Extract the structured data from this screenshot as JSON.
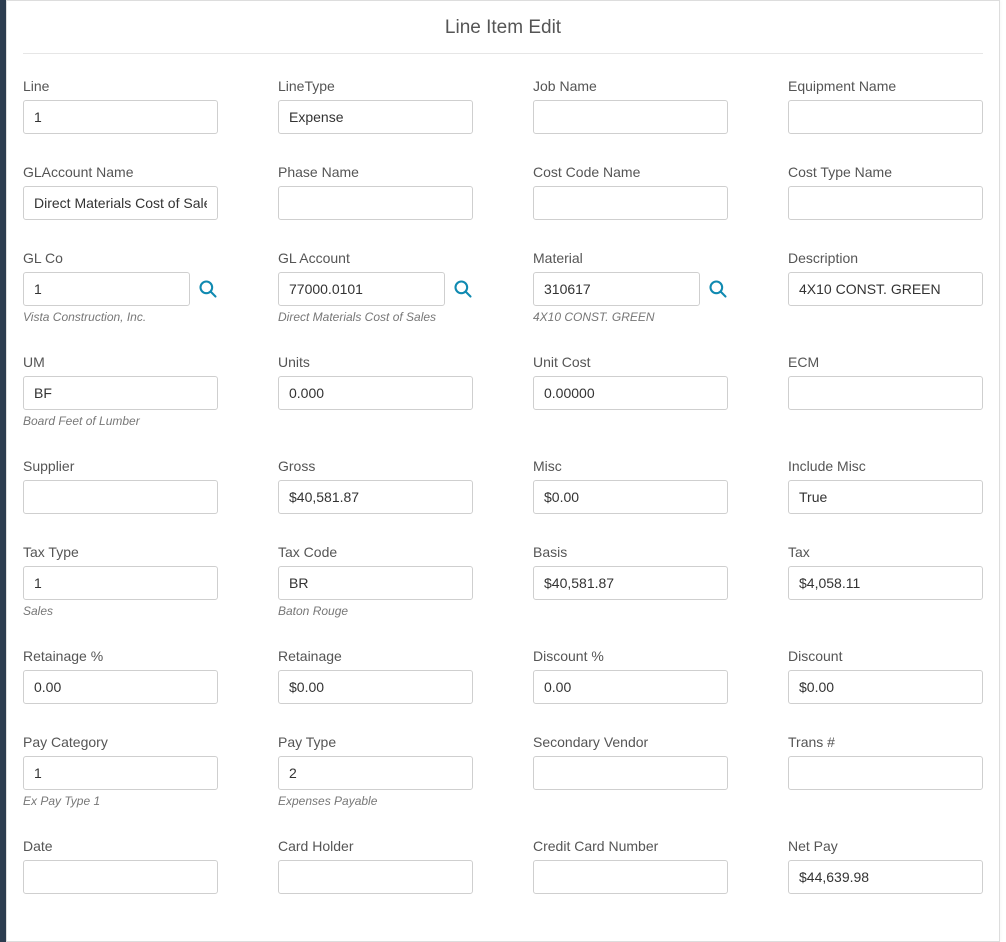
{
  "title": "Line Item Edit",
  "fields": {
    "line": {
      "label": "Line",
      "value": "1"
    },
    "line_type": {
      "label": "LineType",
      "value": "Expense"
    },
    "job_name": {
      "label": "Job Name",
      "value": ""
    },
    "equipment_name": {
      "label": "Equipment Name",
      "value": ""
    },
    "gl_account_name": {
      "label": "GLAccount Name",
      "value": "Direct Materials Cost of Sales"
    },
    "phase_name": {
      "label": "Phase Name",
      "value": ""
    },
    "cost_code_name": {
      "label": "Cost Code Name",
      "value": ""
    },
    "cost_type_name": {
      "label": "Cost Type Name",
      "value": ""
    },
    "gl_co": {
      "label": "GL Co",
      "value": "1",
      "helper": "Vista Construction, Inc."
    },
    "gl_account": {
      "label": "GL Account",
      "value": "77000.0101",
      "helper": "Direct Materials Cost of Sales"
    },
    "material": {
      "label": "Material",
      "value": "310617",
      "helper": "4X10 CONST. GREEN"
    },
    "description": {
      "label": "Description",
      "value": "4X10 CONST. GREEN"
    },
    "um": {
      "label": "UM",
      "value": "BF",
      "helper": "Board Feet of Lumber"
    },
    "units": {
      "label": "Units",
      "value": "0.000"
    },
    "unit_cost": {
      "label": "Unit Cost",
      "value": "0.00000"
    },
    "ecm": {
      "label": "ECM",
      "value": ""
    },
    "supplier": {
      "label": "Supplier",
      "value": ""
    },
    "gross": {
      "label": "Gross",
      "value": "$40,581.87"
    },
    "misc": {
      "label": "Misc",
      "value": "$0.00"
    },
    "include_misc": {
      "label": "Include Misc",
      "value": "True"
    },
    "tax_type": {
      "label": "Tax Type",
      "value": "1",
      "helper": "Sales"
    },
    "tax_code": {
      "label": "Tax Code",
      "value": "BR",
      "helper": "Baton Rouge"
    },
    "basis": {
      "label": "Basis",
      "value": "$40,581.87"
    },
    "tax": {
      "label": "Tax",
      "value": "$4,058.11"
    },
    "retainage_pct": {
      "label": "Retainage %",
      "value": "0.00"
    },
    "retainage": {
      "label": "Retainage",
      "value": "$0.00"
    },
    "discount_pct": {
      "label": "Discount %",
      "value": "0.00"
    },
    "discount": {
      "label": "Discount",
      "value": "$0.00"
    },
    "pay_category": {
      "label": "Pay Category",
      "value": "1",
      "helper": "Ex Pay Type 1"
    },
    "pay_type": {
      "label": "Pay Type",
      "value": "2",
      "helper": "Expenses Payable"
    },
    "secondary_vendor": {
      "label": "Secondary Vendor",
      "value": ""
    },
    "trans_no": {
      "label": "Trans #",
      "value": ""
    },
    "date": {
      "label": "Date",
      "value": ""
    },
    "card_holder": {
      "label": "Card Holder",
      "value": ""
    },
    "credit_card_number": {
      "label": "Credit Card Number",
      "value": ""
    },
    "net_pay": {
      "label": "Net Pay",
      "value": "$44,639.98"
    }
  }
}
